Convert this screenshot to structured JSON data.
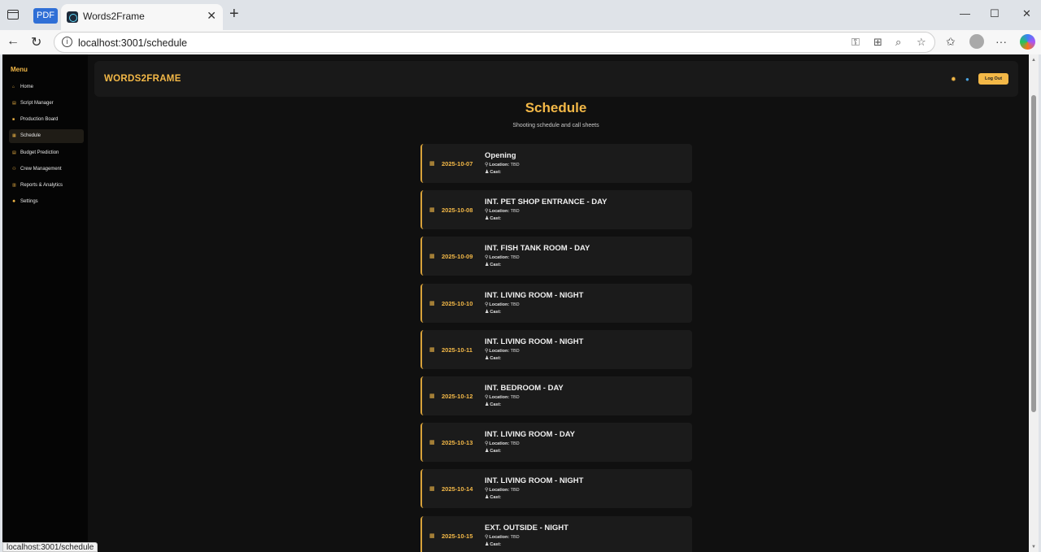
{
  "browser": {
    "pdf_tab_label": "PDF",
    "tab_title": "Words2Frame",
    "url": "localhost:3001/schedule",
    "status_url": "localhost:3001/schedule"
  },
  "sidebar": {
    "title": "Menu",
    "items": [
      {
        "label": "Home",
        "icon": "home-icon",
        "glyph": "⌂"
      },
      {
        "label": "Script Manager",
        "icon": "document-icon",
        "glyph": "▤"
      },
      {
        "label": "Production Board",
        "icon": "camera-icon",
        "glyph": "■"
      },
      {
        "label": "Schedule",
        "icon": "calendar-icon",
        "glyph": "▦"
      },
      {
        "label": "Budget Prediction",
        "icon": "budget-icon",
        "glyph": "▤"
      },
      {
        "label": "Crew Management",
        "icon": "users-icon",
        "glyph": "⚇"
      },
      {
        "label": "Reports & Analytics",
        "icon": "chart-icon",
        "glyph": "▥"
      },
      {
        "label": "Settings",
        "icon": "gear-icon",
        "glyph": "✹"
      }
    ],
    "active_index": 3
  },
  "header": {
    "brand": "WORDS2FRAME",
    "logout_label": "Log Out"
  },
  "page": {
    "title": "Schedule",
    "subtitle": "Shooting schedule and call sheets"
  },
  "schedule": {
    "location_label": "Location:",
    "cast_label": "Cast:",
    "entries": [
      {
        "date": "2025-10-07",
        "scene": "Opening",
        "location": "TBD",
        "cast": ""
      },
      {
        "date": "2025-10-08",
        "scene": "INT. PET SHOP ENTRANCE - DAY",
        "location": "TBD",
        "cast": ""
      },
      {
        "date": "2025-10-09",
        "scene": "INT. FISH TANK ROOM - DAY",
        "location": "TBD",
        "cast": ""
      },
      {
        "date": "2025-10-10",
        "scene": "INT. LIVING ROOM - NIGHT",
        "location": "TBD",
        "cast": ""
      },
      {
        "date": "2025-10-11",
        "scene": "INT. LIVING ROOM - NIGHT",
        "location": "TBD",
        "cast": ""
      },
      {
        "date": "2025-10-12",
        "scene": "INT. BEDROOM - DAY",
        "location": "TBD",
        "cast": ""
      },
      {
        "date": "2025-10-13",
        "scene": "INT. LIVING ROOM - DAY",
        "location": "TBD",
        "cast": ""
      },
      {
        "date": "2025-10-14",
        "scene": "INT. LIVING ROOM - NIGHT",
        "location": "TBD",
        "cast": ""
      },
      {
        "date": "2025-10-15",
        "scene": "EXT. OUTSIDE - NIGHT",
        "location": "TBD",
        "cast": ""
      }
    ]
  },
  "colors": {
    "accent": "#f3b847",
    "background": "#101010",
    "card": "#1b1b1b"
  }
}
